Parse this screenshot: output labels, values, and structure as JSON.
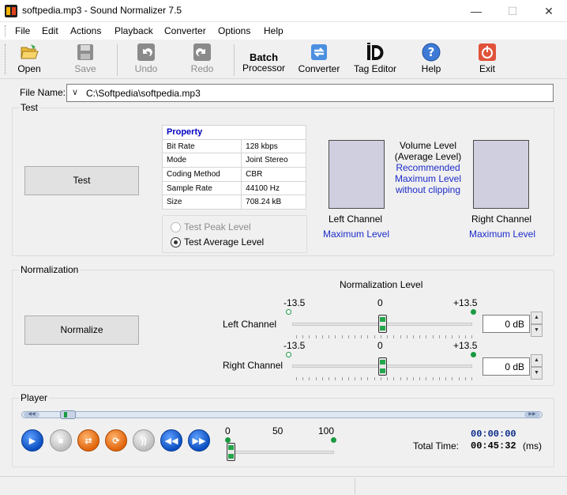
{
  "window": {
    "title": "softpedia.mp3 - Sound Normalizer 7.5"
  },
  "menu": [
    "File",
    "Edit",
    "Actions",
    "Playback",
    "Converter",
    "Options",
    "Help"
  ],
  "toolbar": {
    "open": "Open",
    "save": "Save",
    "undo": "Undo",
    "redo": "Redo",
    "batch_line1": "Batch",
    "batch_line2": "Processor",
    "converter": "Converter",
    "tag_editor": "Tag Editor",
    "help": "Help",
    "exit": "Exit"
  },
  "file": {
    "label": "File Name:",
    "value": "C:\\Softpedia\\softpedia.mp3"
  },
  "test": {
    "group_title": "Test",
    "test_button": "Test",
    "property_header": "Property",
    "properties": [
      {
        "name": "Bit Rate",
        "value": "128 kbps"
      },
      {
        "name": "Mode",
        "value": "Joint Stereo"
      },
      {
        "name": "Coding Method",
        "value": "CBR"
      },
      {
        "name": "Sample Rate",
        "value": "44100 Hz"
      },
      {
        "name": "Size",
        "value": "708.24 kB"
      }
    ],
    "radio_peak": "Test Peak Level",
    "radio_average": "Test Average Level",
    "selected_mode": "average",
    "volume_title_1": "Volume Level",
    "volume_title_2": "(Average Level)",
    "recommended_1": "Recommended",
    "recommended_2": "Maximum Level",
    "recommended_3": "without clipping",
    "left_channel": "Left Channel",
    "right_channel": "Right Channel",
    "left_max": "Maximum Level",
    "right_max": "Maximum Level"
  },
  "normalization": {
    "group_title": "Normalization",
    "normalize_button": "Normalize",
    "level_title": "Normalization Level",
    "min_label": "-13.5",
    "mid_label": "0",
    "max_label": "+13.5",
    "range": [
      -13.5,
      13.5
    ],
    "left_label": "Left Channel",
    "right_label": "Right Channel",
    "left_value_db": 0,
    "right_value_db": 0,
    "left_field": "0 dB",
    "right_field": "0 dB"
  },
  "player": {
    "group_title": "Player",
    "position_fraction": 0.04,
    "volume_scale": {
      "min": "0",
      "mid": "50",
      "max": "100"
    },
    "volume_value": 0,
    "current_time": "00:00:00",
    "total_label": "Total Time:",
    "total_time": "00:45:32",
    "total_unit": "(ms)"
  },
  "colors": {
    "accent_blue": "#1c2bc9",
    "property_header": "#0000c0",
    "slider_green": "#1a9a41"
  }
}
